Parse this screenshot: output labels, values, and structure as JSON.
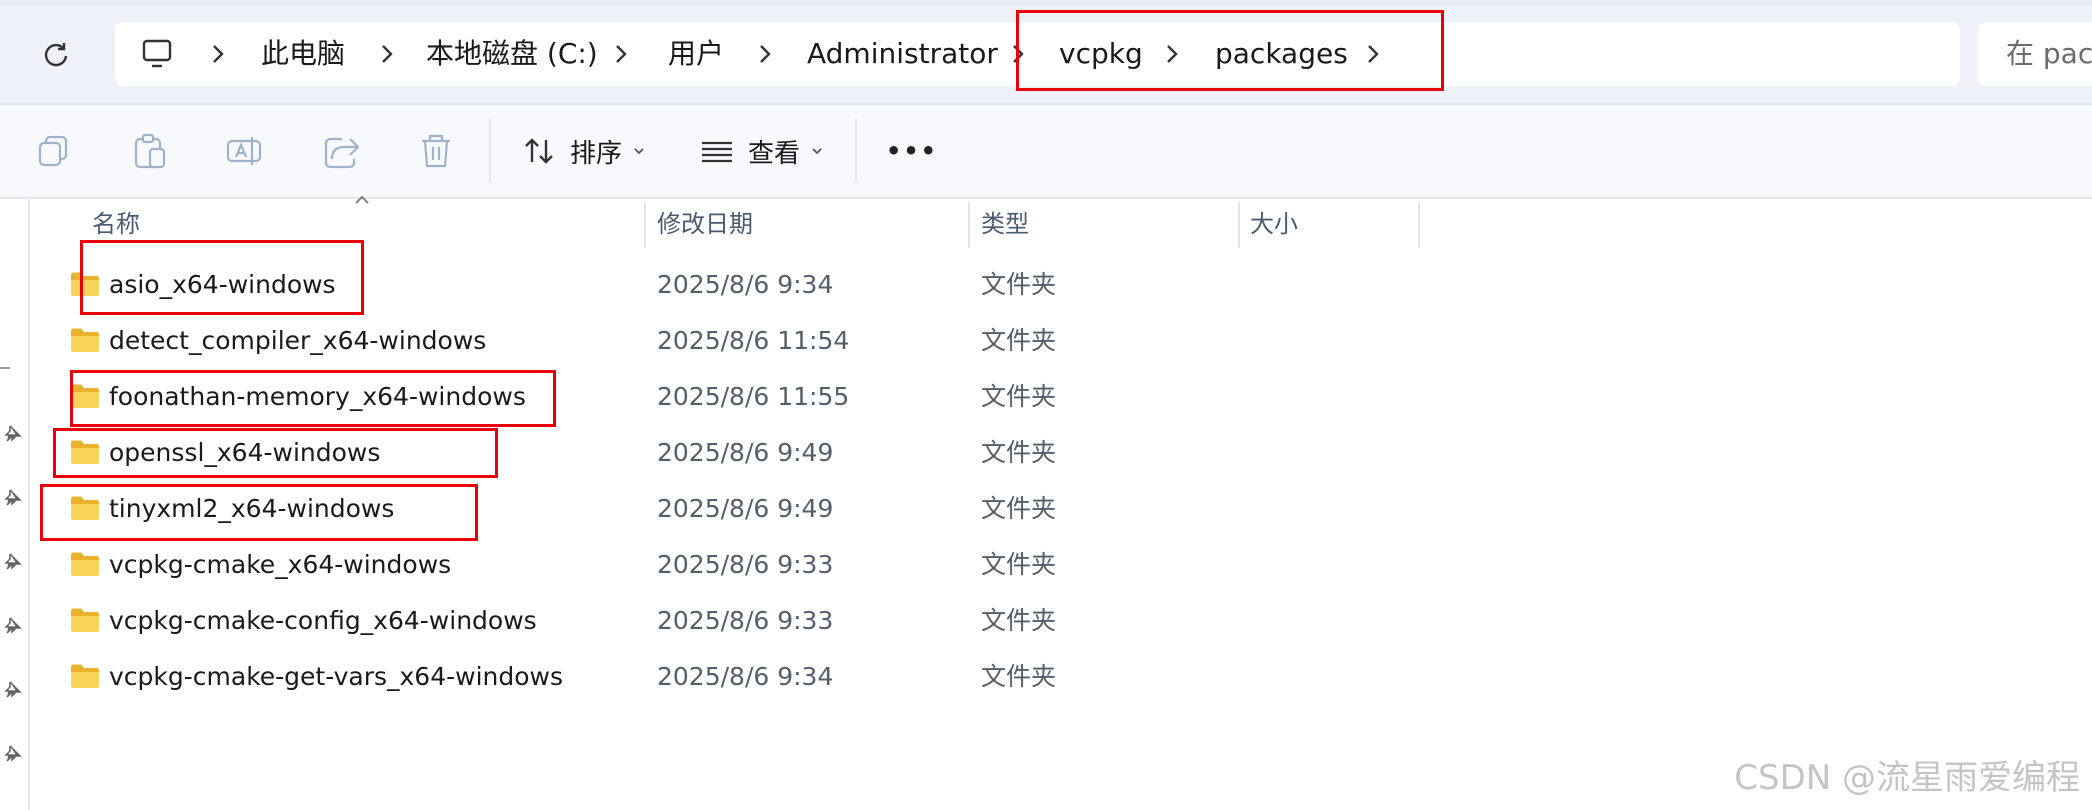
{
  "breadcrumb": {
    "items": [
      "此电脑",
      "本地磁盘 (C:)",
      "用户",
      "Administrator",
      "vcpkg",
      "packages"
    ]
  },
  "search": {
    "placeholder": "在 packages 中搜索",
    "visible_text": "在 pacl"
  },
  "toolbar": {
    "sort_label": "排序",
    "view_label": "查看",
    "more_label": "•••"
  },
  "columns": {
    "name": "名称",
    "modified": "修改日期",
    "type": "类型",
    "size": "大小"
  },
  "rows": [
    {
      "name": "asio_x64-windows",
      "modified": "2025/8/6 9:34",
      "type": "文件夹",
      "size": ""
    },
    {
      "name": "detect_compiler_x64-windows",
      "modified": "2025/8/6 11:54",
      "type": "文件夹",
      "size": ""
    },
    {
      "name": "foonathan-memory_x64-windows",
      "modified": "2025/8/6 11:55",
      "type": "文件夹",
      "size": ""
    },
    {
      "name": "openssl_x64-windows",
      "modified": "2025/8/6 9:49",
      "type": "文件夹",
      "size": ""
    },
    {
      "name": "tinyxml2_x64-windows",
      "modified": "2025/8/6 9:49",
      "type": "文件夹",
      "size": ""
    },
    {
      "name": "vcpkg-cmake_x64-windows",
      "modified": "2025/8/6 9:33",
      "type": "文件夹",
      "size": ""
    },
    {
      "name": "vcpkg-cmake-config_x64-windows",
      "modified": "2025/8/6 9:33",
      "type": "文件夹",
      "size": ""
    },
    {
      "name": "vcpkg-cmake-get-vars_x64-windows",
      "modified": "2025/8/6 9:34",
      "type": "文件夹",
      "size": ""
    }
  ],
  "watermark": "CSDN @流星雨爱编程",
  "icons": {
    "refresh": "refresh-icon",
    "computer": "computer-icon",
    "chevron": "chevron-right-icon",
    "copy": "copy-icon",
    "paste": "paste-icon",
    "rename": "rename-icon",
    "share": "share-icon",
    "delete": "delete-icon",
    "sort": "sort-icon",
    "view": "view-icon",
    "folder": "folder-icon",
    "pin": "pin-icon"
  },
  "colors": {
    "highlight": "#e8000b",
    "folder": "#f4c542",
    "address_bg": "#eef2f8"
  }
}
